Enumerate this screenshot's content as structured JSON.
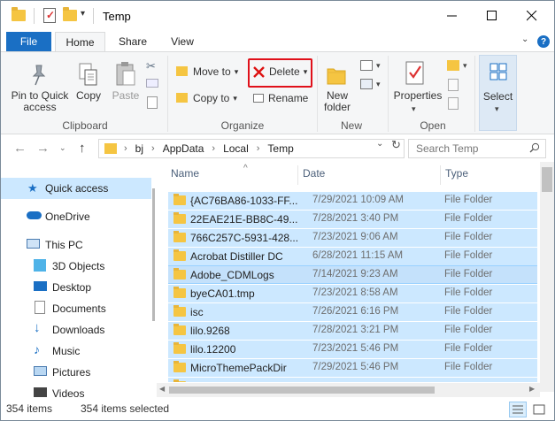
{
  "title": "Temp",
  "tabs": {
    "file": "File",
    "home": "Home",
    "share": "Share",
    "view": "View"
  },
  "ribbon": {
    "clipboard": {
      "label": "Clipboard",
      "pin_line1": "Pin to Quick",
      "pin_line2": "access",
      "copy": "Copy",
      "paste": "Paste"
    },
    "organize": {
      "label": "Organize",
      "move_to": "Move to",
      "copy_to": "Copy to",
      "delete": "Delete",
      "rename": "Rename"
    },
    "new": {
      "label": "New",
      "new_folder_line1": "New",
      "new_folder_line2": "folder"
    },
    "open": {
      "label": "Open",
      "properties": "Properties"
    },
    "select": {
      "label": "Select"
    }
  },
  "address": {
    "crumbs": [
      "bj",
      "AppData",
      "Local",
      "Temp"
    ],
    "search_placeholder": "Search Temp"
  },
  "nav": {
    "items": [
      {
        "label": "Quick access",
        "icon": "star-icon"
      },
      {
        "label": "OneDrive",
        "icon": "cloud-icon"
      },
      {
        "label": "This PC",
        "icon": "computer-icon"
      },
      {
        "label": "3D Objects",
        "icon": "cube-icon"
      },
      {
        "label": "Desktop",
        "icon": "desktop-icon"
      },
      {
        "label": "Documents",
        "icon": "document-icon"
      },
      {
        "label": "Downloads",
        "icon": "download-icon"
      },
      {
        "label": "Music",
        "icon": "music-icon"
      },
      {
        "label": "Pictures",
        "icon": "picture-icon"
      },
      {
        "label": "Videos",
        "icon": "video-icon"
      }
    ]
  },
  "columns": {
    "name": "Name",
    "date": "Date",
    "type": "Type"
  },
  "files": [
    {
      "name": "{AC76BA86-1033-FF...",
      "date": "7/29/2021 10:09 AM",
      "type": "File Folder"
    },
    {
      "name": "22EAE21E-BB8C-49...",
      "date": "7/28/2021 3:40 PM",
      "type": "File Folder"
    },
    {
      "name": "766C257C-5931-428...",
      "date": "7/23/2021 9:06 AM",
      "type": "File Folder"
    },
    {
      "name": "Acrobat Distiller DC",
      "date": "6/28/2021 11:15 AM",
      "type": "File Folder"
    },
    {
      "name": "Adobe_CDMLogs",
      "date": "7/14/2021 9:23 AM",
      "type": "File Folder"
    },
    {
      "name": "byeCA01.tmp",
      "date": "7/23/2021 8:58 AM",
      "type": "File Folder"
    },
    {
      "name": "isc",
      "date": "7/26/2021 6:16 PM",
      "type": "File Folder"
    },
    {
      "name": "lilo.9268",
      "date": "7/28/2021 3:21 PM",
      "type": "File Folder"
    },
    {
      "name": "lilo.12200",
      "date": "7/23/2021 5:46 PM",
      "type": "File Folder"
    },
    {
      "name": "MicroThemePackDir",
      "date": "7/29/2021 5:46 PM",
      "type": "File Folder"
    }
  ],
  "status": {
    "count": "354 items",
    "selected": "354 items selected"
  },
  "colors": {
    "accent": "#1a6fc4",
    "selection": "#cce8ff",
    "highlight_border": "#e0101a"
  }
}
